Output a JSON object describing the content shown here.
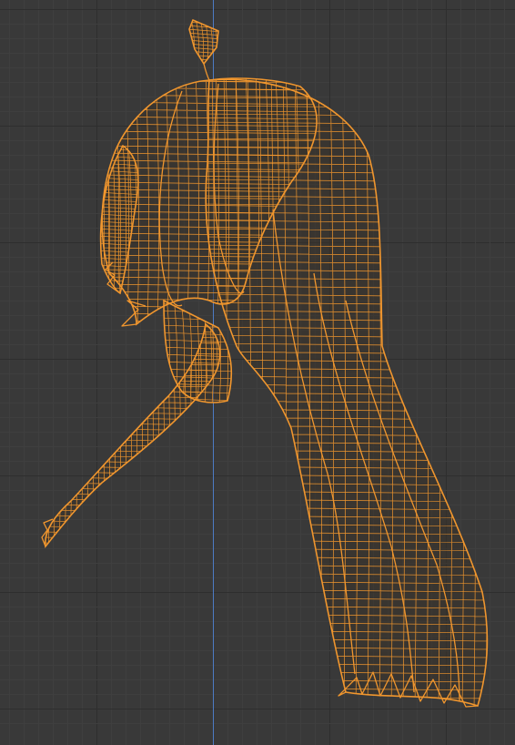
{
  "viewport": {
    "background_color": "#393939",
    "minor_grid_color": "#3f3f3f",
    "major_grid_color": "#2e2e2e",
    "vertical_axis_color": "#4d7bc4",
    "wireframe_color": "#f0962e",
    "wireframe_fill": "#3a332a",
    "mode": "wireframe-edit"
  },
  "object": {
    "icon": "hair-mesh-wireframe-icon",
    "strands": [
      "ahoge-strand",
      "scalp-cap",
      "left-side-bangs",
      "long-back-hair",
      "front-strand"
    ]
  }
}
